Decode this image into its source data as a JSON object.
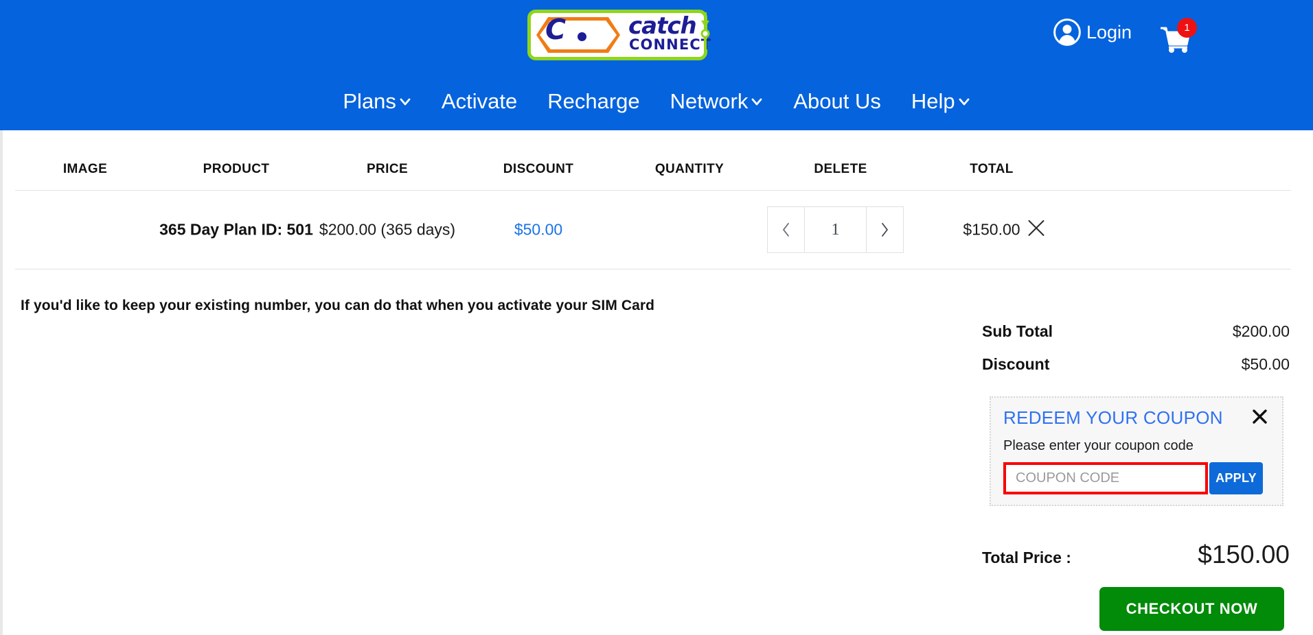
{
  "header": {
    "logo": {
      "mark_letter": "C",
      "word_top": "catch",
      "word_bottom": "CONNECT",
      "colors": {
        "brand_blue": "#0563dd",
        "logo_navy": "#1d1d96",
        "logo_green": "#8ed61a",
        "logo_orange": "#f07c15"
      }
    },
    "login_label": "Login",
    "login_icon": "user-circle-icon",
    "cart_icon": "shopping-cart-icon",
    "cart_count": "1",
    "nav": [
      {
        "label": "Plans",
        "has_dropdown": true
      },
      {
        "label": "Activate",
        "has_dropdown": false
      },
      {
        "label": "Recharge",
        "has_dropdown": false
      },
      {
        "label": "Network",
        "has_dropdown": true
      },
      {
        "label": "About Us",
        "has_dropdown": false
      },
      {
        "label": "Help",
        "has_dropdown": true
      }
    ]
  },
  "cart_table": {
    "columns": [
      "IMAGE",
      "PRODUCT",
      "PRICE",
      "DISCOUNT",
      "QUANTITY",
      "DELETE",
      "TOTAL"
    ],
    "rows": [
      {
        "image": "",
        "product": "365 Day Plan ID: 501",
        "price": "$200.00 (365 days)",
        "discount": "$50.00",
        "quantity": "1",
        "qty_decrement_icon": "chevron-left-icon",
        "qty_increment_icon": "chevron-right-icon",
        "delete_icon": "close-x-icon",
        "total": "$150.00"
      }
    ]
  },
  "note": "If you'd like to keep your existing number, you can do that when you activate your SIM Card",
  "summary": {
    "rows": [
      {
        "label": "Sub Total",
        "value": "$200.00"
      },
      {
        "label": "Discount",
        "value": "$50.00"
      }
    ],
    "total_label": "Total Price :",
    "total_value": "$150.00",
    "checkout_label": "CHECKOUT NOW",
    "checkout_color": "#028a09"
  },
  "coupon": {
    "title": "REDEEM YOUR COUPON",
    "title_color": "#2f71f2",
    "close_icon": "close-x-icon",
    "subtitle": "Please enter your coupon code",
    "input_value": "",
    "input_placeholder": "COUPON CODE",
    "input_highlight_color": "#fb0000",
    "apply_label": "APPLY",
    "apply_color": "#0e6ad8"
  }
}
